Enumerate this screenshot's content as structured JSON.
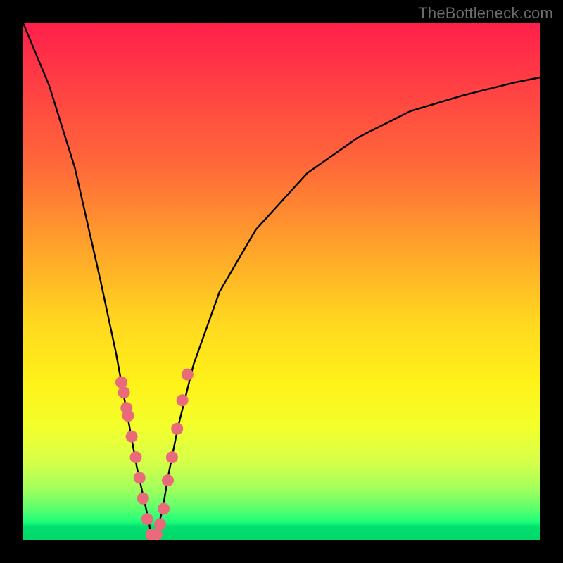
{
  "watermark": "TheBottleneck.com",
  "colors": {
    "frame": "#000000",
    "gradient_top": "#ff1f4b",
    "gradient_mid": "#fff21a",
    "gradient_bottom": "#00d868",
    "curve": "#000000",
    "marker": "#e96a7a"
  },
  "chart_data": {
    "type": "line",
    "title": "",
    "xlabel": "",
    "ylabel": "",
    "xlim": [
      0,
      1
    ],
    "ylim": [
      0,
      1
    ],
    "series": [
      {
        "name": "bottleneck-curve",
        "x": [
          0.0,
          0.05,
          0.1,
          0.15,
          0.18,
          0.2,
          0.22,
          0.24,
          0.25,
          0.26,
          0.27,
          0.28,
          0.3,
          0.33,
          0.38,
          0.45,
          0.55,
          0.65,
          0.75,
          0.85,
          0.95,
          1.0
        ],
        "y": [
          1.0,
          0.88,
          0.72,
          0.5,
          0.36,
          0.25,
          0.14,
          0.05,
          0.0,
          0.02,
          0.06,
          0.12,
          0.22,
          0.34,
          0.48,
          0.6,
          0.71,
          0.78,
          0.83,
          0.86,
          0.885,
          0.895
        ]
      }
    ],
    "markers": {
      "name": "data-points",
      "x": [
        0.19,
        0.195,
        0.2,
        0.203,
        0.21,
        0.218,
        0.225,
        0.232,
        0.24,
        0.248,
        0.258,
        0.265,
        0.272,
        0.28,
        0.288,
        0.298,
        0.308,
        0.318
      ],
      "y": [
        0.305,
        0.285,
        0.255,
        0.24,
        0.2,
        0.16,
        0.12,
        0.08,
        0.04,
        0.01,
        0.01,
        0.03,
        0.06,
        0.115,
        0.16,
        0.215,
        0.27,
        0.32
      ]
    }
  }
}
